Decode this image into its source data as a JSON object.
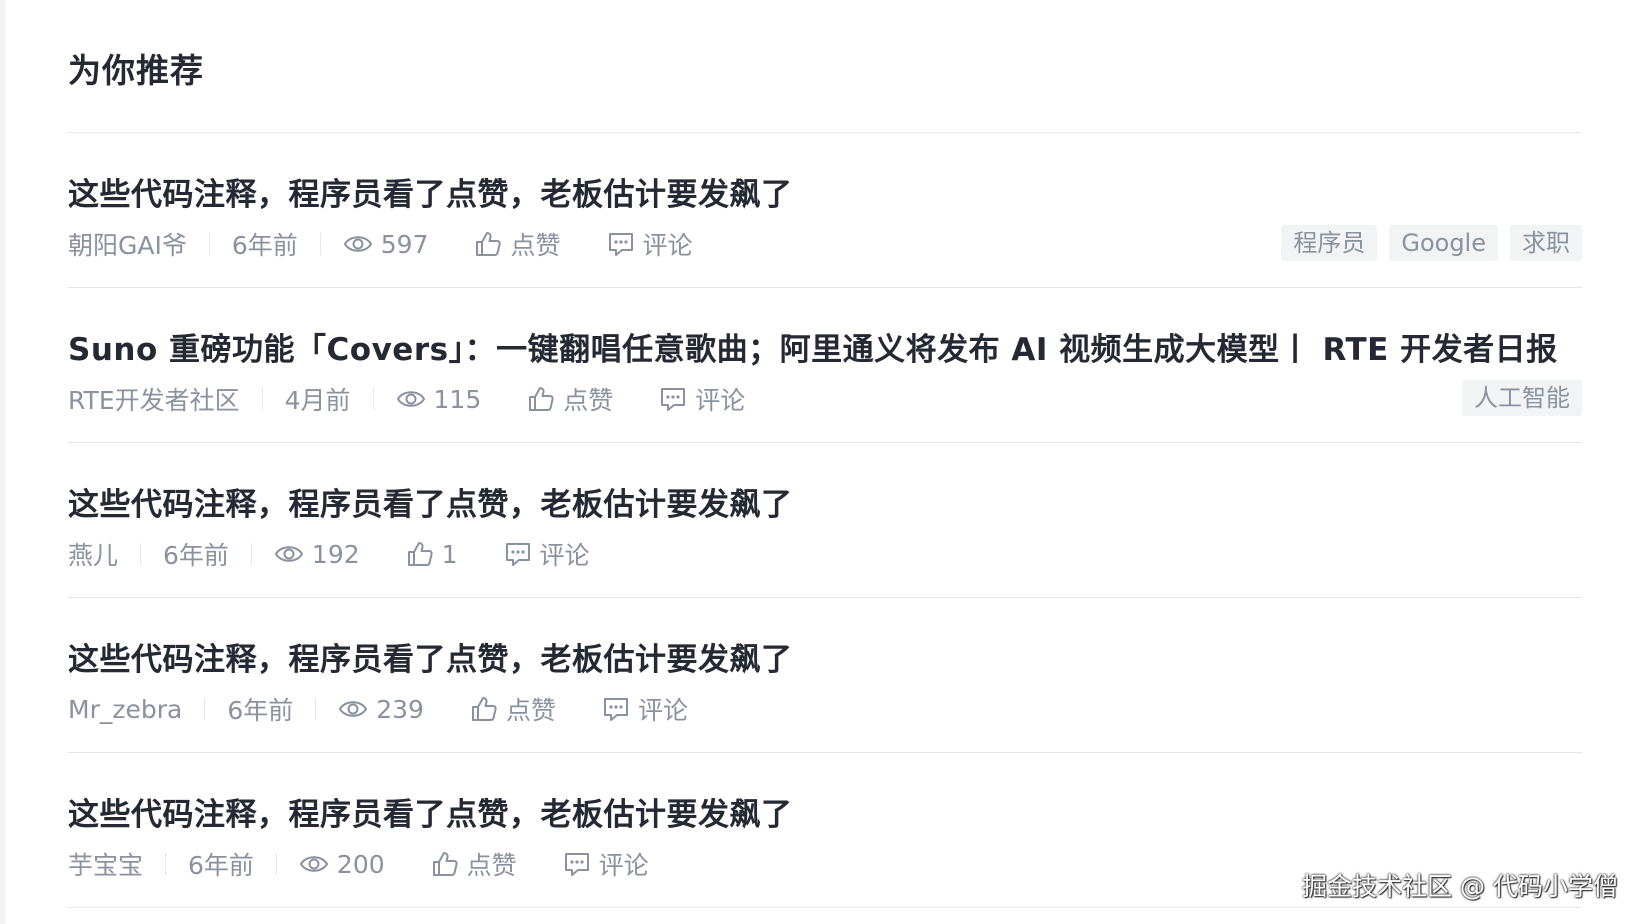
{
  "section_title": "为你推荐",
  "articles": [
    {
      "title": "这些代码注释，程序员看了点赞，老板估计要发飙了",
      "author": "朝阳GAI爷",
      "time": "6年前",
      "views": "597",
      "likes": "点赞",
      "comments": "评论",
      "tags": [
        "程序员",
        "Google",
        "求职"
      ]
    },
    {
      "title": "Suno 重磅功能「Covers」：一键翻唱任意歌曲；阿里通义将发布 AI 视频生成大模型丨 RTE 开发者日报",
      "author": "RTE开发者社区",
      "time": "4月前",
      "views": "115",
      "likes": "点赞",
      "comments": "评论",
      "tags": [
        "人工智能"
      ]
    },
    {
      "title": "这些代码注释，程序员看了点赞，老板估计要发飙了",
      "author": "燕儿",
      "time": "6年前",
      "views": "192",
      "likes": "1",
      "comments": "评论",
      "tags": []
    },
    {
      "title": "这些代码注释，程序员看了点赞，老板估计要发飙了",
      "author": "Mr_zebra",
      "time": "6年前",
      "views": "239",
      "likes": "点赞",
      "comments": "评论",
      "tags": []
    },
    {
      "title": "这些代码注释，程序员看了点赞，老板估计要发飙了",
      "author": "芋宝宝",
      "time": "6年前",
      "views": "200",
      "likes": "点赞",
      "comments": "评论",
      "tags": []
    }
  ],
  "icons": {
    "views": "eye-icon",
    "likes": "thumbs-up-icon",
    "comments": "comment-icon"
  },
  "watermark": "掘金技术社区 @ 代码小学僧"
}
